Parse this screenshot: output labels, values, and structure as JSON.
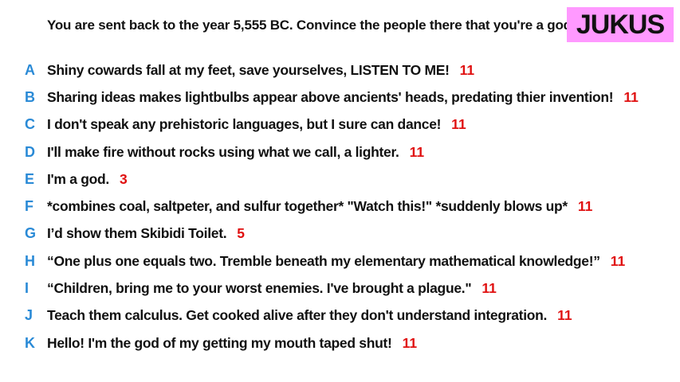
{
  "prompt": "You are sent back to the year 5,555 BC. Convince the people there that you're a god.",
  "brand": {
    "label": "JUKUS",
    "color": "#ff99ff"
  },
  "colors": {
    "letter": "#2a8ad6",
    "score": "#e01010",
    "text": "#111111"
  },
  "answers": [
    {
      "letter": "A",
      "text": "Shiny cowards fall at my feet, save yourselves, LISTEN TO ME!",
      "score": "11"
    },
    {
      "letter": "B",
      "text": "Sharing ideas makes lightbulbs appear above ancients' heads, predating thier invention!",
      "score": "11"
    },
    {
      "letter": "C",
      "text": "I don't speak any prehistoric languages, but I sure can dance!",
      "score": "11"
    },
    {
      "letter": "D",
      "text": "I'll make fire without rocks using what we call, a lighter.",
      "score": "11"
    },
    {
      "letter": "E",
      "text": "I'm a god.",
      "score": "3"
    },
    {
      "letter": "F",
      "text": "*combines coal, saltpeter, and sulfur together* \"Watch this!\" *suddenly blows up*",
      "score": "11"
    },
    {
      "letter": "G",
      "text": "I’d show them Skibidi Toilet.",
      "score": "5"
    },
    {
      "letter": "H",
      "text": "“One plus one equals two. Tremble beneath my elementary mathematical knowledge!”",
      "score": "11"
    },
    {
      "letter": "I",
      "text": "“Children, bring me to your worst enemies.  I've brought a plague.\"",
      "score": "11"
    },
    {
      "letter": "J",
      "text": "Teach them calculus. Get cooked alive after they don't understand integration.",
      "score": "11"
    },
    {
      "letter": "K",
      "text": "Hello! I'm the god of my getting my mouth taped shut!",
      "score": "11"
    }
  ]
}
